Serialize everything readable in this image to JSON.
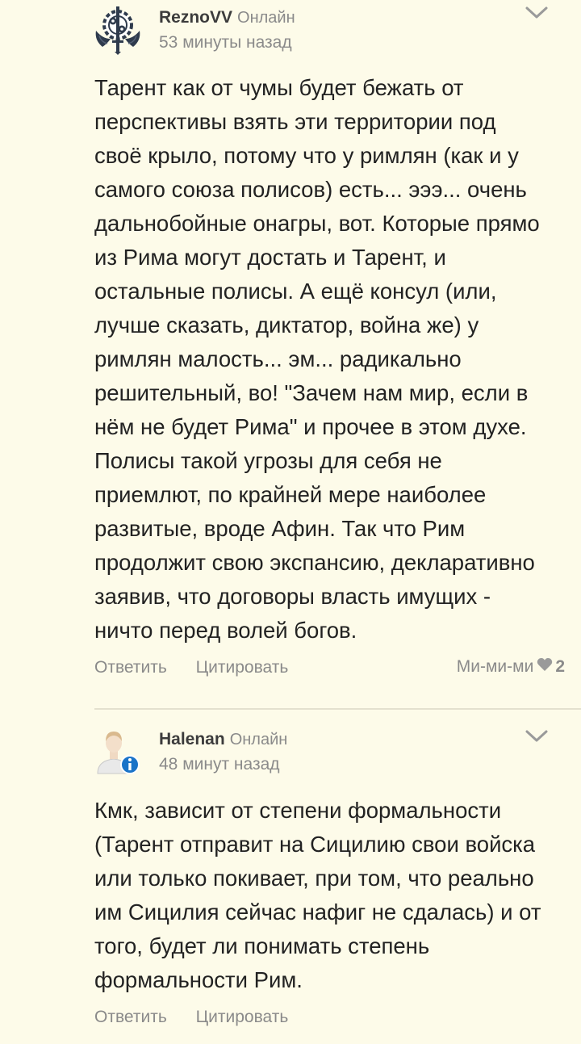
{
  "comments": [
    {
      "username": "ReznoVV",
      "status": "Онлайн",
      "time": "53 минуты назад",
      "lines": [
        "Тарент как от чумы будет бежать от",
        "перспективы взять эти территории под",
        "своё крыло, потому что у римлян (как и у",
        "самого союза полисов) есть... эээ... очень",
        "дальнобойные онагры, вот. Которые прямо",
        "из Рима могут достать и Тарент, и",
        "остальные полисы. А ещё консул (или,",
        "лучше сказать, диктатор, война же) у",
        "римлян малость... эм... радикально",
        "решительный, во! \"Зачем нам мир, если в",
        "нём не будет Рима\" и прочее в этом духе.",
        "Полисы такой угрозы для себя не",
        "приемлют, по крайней мере наиболее",
        "развитые, вроде Афин. Так что Рим",
        "продолжит свою экспансию, декларативно",
        "заявив, что договоры власть имущих -",
        "ничто перед волей богов."
      ],
      "reply_label": "Ответить",
      "quote_label": "Цитировать",
      "like_label": "Ми-ми-ми",
      "like_count": "2"
    },
    {
      "username": "Halenan",
      "status": "Онлайн",
      "time": "48 минут назад",
      "lines": [
        "Кмк, зависит от степени формальности",
        "(Тарент отправит на Сицилию свои войска",
        "или только покивает, при том, что реально",
        "им Сицилия сейчас нафиг не сдалась) и от",
        "того, будет ли понимать степень",
        "формальности Рим."
      ],
      "reply_label": "Ответить",
      "quote_label": "Цитировать"
    }
  ],
  "icons": {
    "avatar_1": "brotherhood-gear-emblem-icon",
    "avatar_2": "default-user-info-icon",
    "chevron": "chevron-down-icon",
    "heart": "heart-icon"
  },
  "colors": {
    "background": "#fdfbe9",
    "text": "#222222",
    "muted": "#8a8a8a",
    "divider": "#e4e1cf",
    "info_badge": "#1a73c8"
  }
}
